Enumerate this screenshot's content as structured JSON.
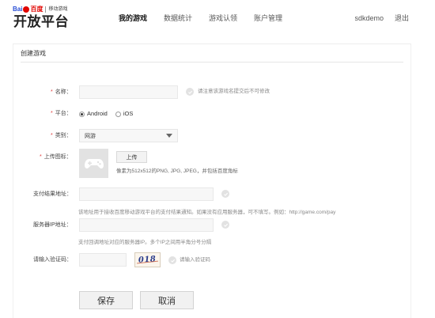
{
  "header": {
    "logo": {
      "bai": "Bai",
      "du": "百度",
      "sub": "移动游戏",
      "main": "开放平台"
    },
    "nav": [
      {
        "label": "我的游戏",
        "active": true
      },
      {
        "label": "数据统计",
        "active": false
      },
      {
        "label": "游戏认领",
        "active": false
      },
      {
        "label": "账户管理",
        "active": false
      }
    ],
    "username": "sdkdemo",
    "logout_label": "退出"
  },
  "form": {
    "title": "创建游戏",
    "required_mark": "*",
    "name": {
      "label": "名称：",
      "value": "",
      "hint": "请注意该游戏名提交后不可修改"
    },
    "platform": {
      "label": "平台：",
      "options": [
        "Android",
        "iOS"
      ],
      "selected": "Android"
    },
    "category": {
      "label": "类别：",
      "selected": "网游"
    },
    "upload_icon": {
      "label": "上传图标：",
      "button_label": "上传",
      "hint": "像素为512x512的PNG, JPG, JPEG，并包括百度角标"
    },
    "payment_url": {
      "label": "支付结果地址：",
      "value": "",
      "hint": "该地址用于接收百度移动游戏平台的支付结果通知。如果没有应用服务器，可不填写。例如：http://game.com/pay"
    },
    "server_ip": {
      "label": "服务器IP地址：",
      "value": "",
      "hint": "支付回调地址对应的服务器IP。多个IP之间用半角分号分隔"
    },
    "captcha": {
      "label": "请输入验证码：",
      "value": "",
      "image_text": "018",
      "hint": "请输入验证码"
    },
    "save_label": "保存",
    "cancel_label": "取消"
  },
  "colors": {
    "brand_blue": "#2a4fd6",
    "brand_red": "#e10602",
    "required": "#e03c3c"
  }
}
